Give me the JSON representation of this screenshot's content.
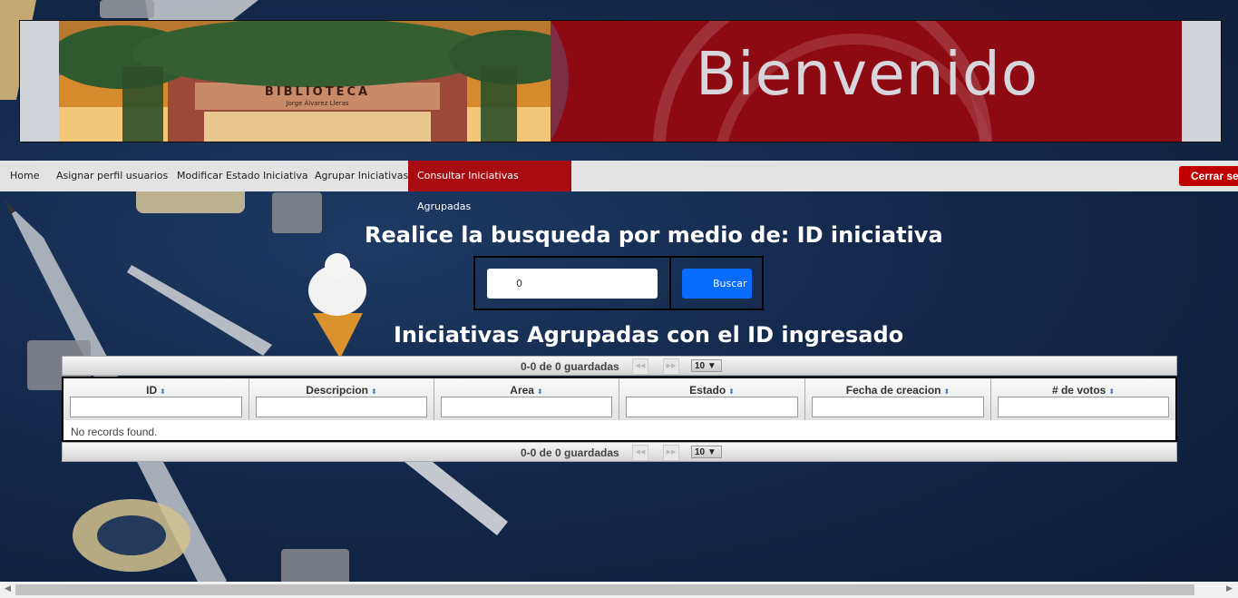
{
  "header": {
    "banner_title": "Bienvenido",
    "photo_sign": "BIBLIOTECA",
    "photo_sign_sub": "Jorge Álvarez Lleras"
  },
  "nav": {
    "items": [
      {
        "label": "Home"
      },
      {
        "label": "Asignar perfil usuarios"
      },
      {
        "label": "Modificar Estado Iniciativa"
      },
      {
        "label": "Agrupar Iniciativas"
      },
      {
        "label": "Consultar Iniciativas Agrupadas"
      }
    ],
    "active_index": 4,
    "logout_label": "Cerrar se"
  },
  "search": {
    "heading": "Realice la busqueda por medio de: ID iniciativa",
    "input_value": "0",
    "button_label": "Buscar"
  },
  "results": {
    "heading": "Iniciativas Agrupadas con el ID ingresado",
    "pager_text": "0-0 de 0 guardadas",
    "rows_per_page": "10",
    "columns": [
      "ID",
      "Descripcion",
      "Area",
      "Estado",
      "Fecha de creacion",
      "# de votos"
    ],
    "empty_message": "No records found."
  },
  "colors": {
    "accent_red": "#a80c12",
    "button_blue": "#0a6cff",
    "background_navy": "#14284a"
  }
}
